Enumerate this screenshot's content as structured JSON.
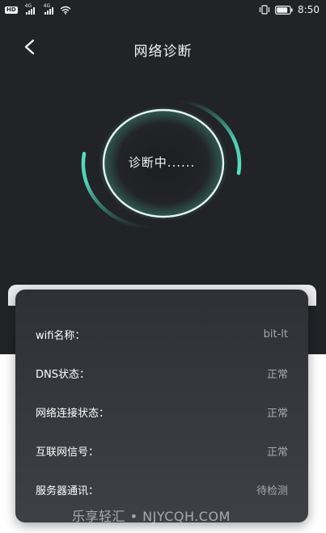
{
  "status_bar": {
    "badge": "HD",
    "network1": "4G",
    "network2": "4G",
    "battery_level": 0.85,
    "time": "8:50"
  },
  "header": {
    "title": "网络诊断",
    "back_icon": "chevron-left-icon"
  },
  "diagnosis": {
    "status_text": "诊断中......",
    "accent_color": "#54e0c2"
  },
  "info": {
    "rows": [
      {
        "label": "wifi名称：",
        "value": "bit-lt"
      },
      {
        "label": "DNS状态：",
        "value": "正常"
      },
      {
        "label": "网络连接状态：",
        "value": "正常"
      },
      {
        "label": "互联网信号：",
        "value": "正常"
      },
      {
        "label": "服务器通讯：",
        "value": "待检测"
      }
    ]
  },
  "watermark": "乐享轻汇 • NJYCQH.COM"
}
